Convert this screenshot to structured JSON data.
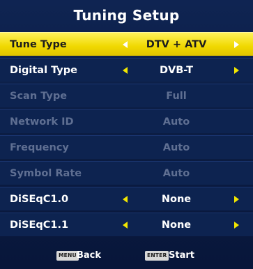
{
  "title": "Tuning Setup",
  "rows": [
    {
      "label": "Tune Type",
      "value": "DTV + ATV",
      "state": "selected"
    },
    {
      "label": "Digital Type",
      "value": "DVB-T",
      "state": "normal"
    },
    {
      "label": "Scan Type",
      "value": "Full",
      "state": "disabled"
    },
    {
      "label": "Network ID",
      "value": "Auto",
      "state": "disabled"
    },
    {
      "label": "Frequency",
      "value": "Auto",
      "state": "disabled"
    },
    {
      "label": "Symbol Rate",
      "value": "Auto",
      "state": "disabled"
    },
    {
      "label": "DiSEqC1.0",
      "value": "None",
      "state": "normal"
    },
    {
      "label": "DiSEqC1.1",
      "value": "None",
      "state": "normal"
    }
  ],
  "footer": {
    "back_key": "MENU",
    "back_label": "Back",
    "start_key": "ENTER",
    "start_label": "Start"
  },
  "colors": {
    "background": "#0d2350",
    "highlight": "#f0d800",
    "arrow": "#f2e600",
    "disabled_text": "#5f6f92"
  },
  "icons": {
    "left": "arrow-left-icon",
    "right": "arrow-right-icon"
  }
}
